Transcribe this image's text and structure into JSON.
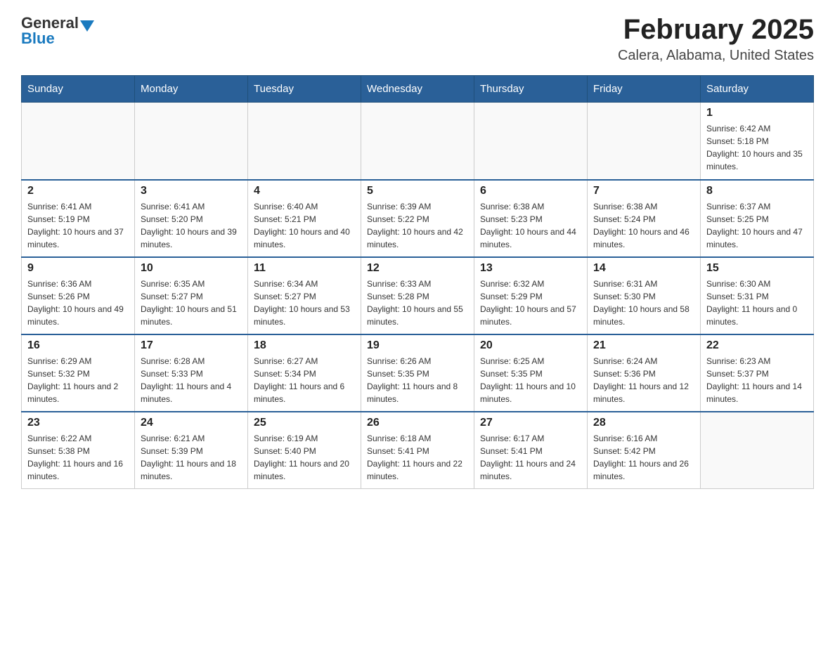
{
  "header": {
    "logo_general": "General",
    "logo_blue": "Blue",
    "title": "February 2025",
    "subtitle": "Calera, Alabama, United States"
  },
  "days_of_week": [
    "Sunday",
    "Monday",
    "Tuesday",
    "Wednesday",
    "Thursday",
    "Friday",
    "Saturday"
  ],
  "weeks": [
    [
      {
        "day": "",
        "info": ""
      },
      {
        "day": "",
        "info": ""
      },
      {
        "day": "",
        "info": ""
      },
      {
        "day": "",
        "info": ""
      },
      {
        "day": "",
        "info": ""
      },
      {
        "day": "",
        "info": ""
      },
      {
        "day": "1",
        "info": "Sunrise: 6:42 AM\nSunset: 5:18 PM\nDaylight: 10 hours and 35 minutes."
      }
    ],
    [
      {
        "day": "2",
        "info": "Sunrise: 6:41 AM\nSunset: 5:19 PM\nDaylight: 10 hours and 37 minutes."
      },
      {
        "day": "3",
        "info": "Sunrise: 6:41 AM\nSunset: 5:20 PM\nDaylight: 10 hours and 39 minutes."
      },
      {
        "day": "4",
        "info": "Sunrise: 6:40 AM\nSunset: 5:21 PM\nDaylight: 10 hours and 40 minutes."
      },
      {
        "day": "5",
        "info": "Sunrise: 6:39 AM\nSunset: 5:22 PM\nDaylight: 10 hours and 42 minutes."
      },
      {
        "day": "6",
        "info": "Sunrise: 6:38 AM\nSunset: 5:23 PM\nDaylight: 10 hours and 44 minutes."
      },
      {
        "day": "7",
        "info": "Sunrise: 6:38 AM\nSunset: 5:24 PM\nDaylight: 10 hours and 46 minutes."
      },
      {
        "day": "8",
        "info": "Sunrise: 6:37 AM\nSunset: 5:25 PM\nDaylight: 10 hours and 47 minutes."
      }
    ],
    [
      {
        "day": "9",
        "info": "Sunrise: 6:36 AM\nSunset: 5:26 PM\nDaylight: 10 hours and 49 minutes."
      },
      {
        "day": "10",
        "info": "Sunrise: 6:35 AM\nSunset: 5:27 PM\nDaylight: 10 hours and 51 minutes."
      },
      {
        "day": "11",
        "info": "Sunrise: 6:34 AM\nSunset: 5:27 PM\nDaylight: 10 hours and 53 minutes."
      },
      {
        "day": "12",
        "info": "Sunrise: 6:33 AM\nSunset: 5:28 PM\nDaylight: 10 hours and 55 minutes."
      },
      {
        "day": "13",
        "info": "Sunrise: 6:32 AM\nSunset: 5:29 PM\nDaylight: 10 hours and 57 minutes."
      },
      {
        "day": "14",
        "info": "Sunrise: 6:31 AM\nSunset: 5:30 PM\nDaylight: 10 hours and 58 minutes."
      },
      {
        "day": "15",
        "info": "Sunrise: 6:30 AM\nSunset: 5:31 PM\nDaylight: 11 hours and 0 minutes."
      }
    ],
    [
      {
        "day": "16",
        "info": "Sunrise: 6:29 AM\nSunset: 5:32 PM\nDaylight: 11 hours and 2 minutes."
      },
      {
        "day": "17",
        "info": "Sunrise: 6:28 AM\nSunset: 5:33 PM\nDaylight: 11 hours and 4 minutes."
      },
      {
        "day": "18",
        "info": "Sunrise: 6:27 AM\nSunset: 5:34 PM\nDaylight: 11 hours and 6 minutes."
      },
      {
        "day": "19",
        "info": "Sunrise: 6:26 AM\nSunset: 5:35 PM\nDaylight: 11 hours and 8 minutes."
      },
      {
        "day": "20",
        "info": "Sunrise: 6:25 AM\nSunset: 5:35 PM\nDaylight: 11 hours and 10 minutes."
      },
      {
        "day": "21",
        "info": "Sunrise: 6:24 AM\nSunset: 5:36 PM\nDaylight: 11 hours and 12 minutes."
      },
      {
        "day": "22",
        "info": "Sunrise: 6:23 AM\nSunset: 5:37 PM\nDaylight: 11 hours and 14 minutes."
      }
    ],
    [
      {
        "day": "23",
        "info": "Sunrise: 6:22 AM\nSunset: 5:38 PM\nDaylight: 11 hours and 16 minutes."
      },
      {
        "day": "24",
        "info": "Sunrise: 6:21 AM\nSunset: 5:39 PM\nDaylight: 11 hours and 18 minutes."
      },
      {
        "day": "25",
        "info": "Sunrise: 6:19 AM\nSunset: 5:40 PM\nDaylight: 11 hours and 20 minutes."
      },
      {
        "day": "26",
        "info": "Sunrise: 6:18 AM\nSunset: 5:41 PM\nDaylight: 11 hours and 22 minutes."
      },
      {
        "day": "27",
        "info": "Sunrise: 6:17 AM\nSunset: 5:41 PM\nDaylight: 11 hours and 24 minutes."
      },
      {
        "day": "28",
        "info": "Sunrise: 6:16 AM\nSunset: 5:42 PM\nDaylight: 11 hours and 26 minutes."
      },
      {
        "day": "",
        "info": ""
      }
    ]
  ]
}
